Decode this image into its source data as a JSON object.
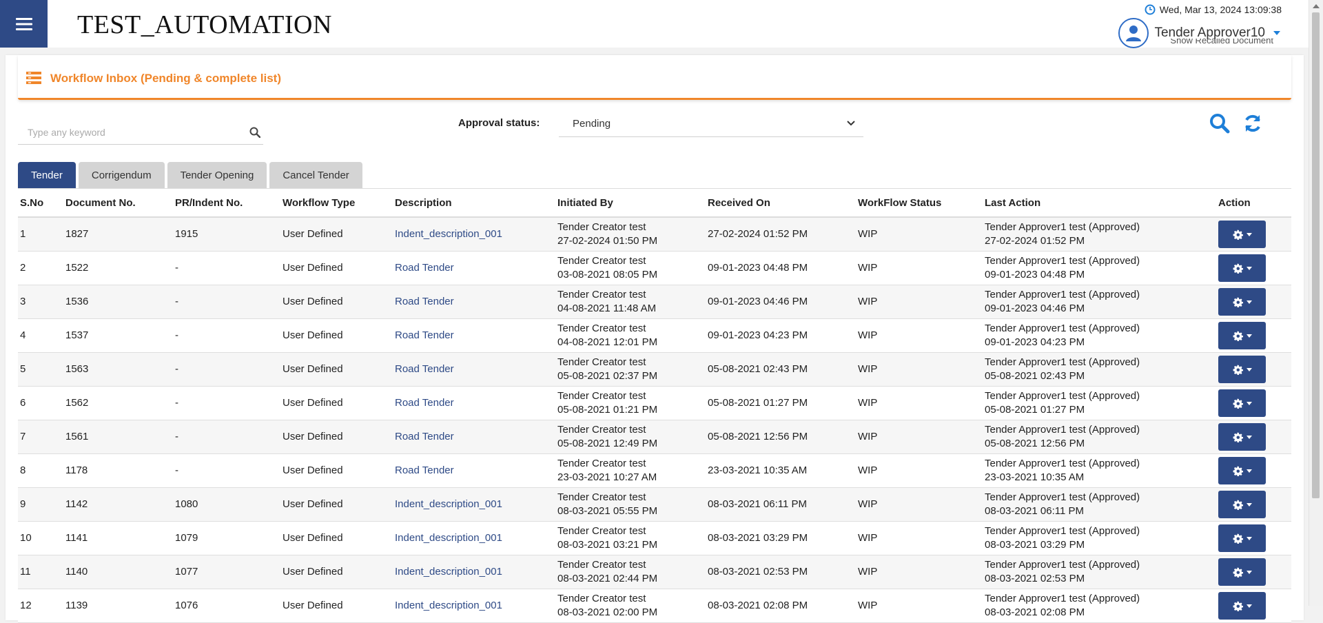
{
  "app": {
    "title": "TEST_AUTOMATION"
  },
  "header": {
    "datetime": "Wed, Mar 13, 2024 13:09:38",
    "user_name": "Tender Approver10",
    "recalled_link": "Show Recalled Document"
  },
  "panel": {
    "title": "Workflow Inbox (Pending & complete list)"
  },
  "search": {
    "placeholder": "Type any keyword",
    "value": ""
  },
  "filter": {
    "label": "Approval status:",
    "selected": "Pending"
  },
  "tabs": [
    {
      "label": "Tender",
      "active": true
    },
    {
      "label": "Corrigendum",
      "active": false
    },
    {
      "label": "Tender Opening",
      "active": false
    },
    {
      "label": "Cancel Tender",
      "active": false
    }
  ],
  "table": {
    "columns": [
      "S.No",
      "Document No.",
      "PR/Indent No.",
      "Workflow Type",
      "Description",
      "Initiated By",
      "Received On",
      "WorkFlow Status",
      "Last Action",
      "Action"
    ],
    "rows": [
      {
        "sno": "1",
        "doc": "1827",
        "pr": "1915",
        "type": "User Defined",
        "desc": "Indent_description_001",
        "init_by": "Tender Creator test",
        "init_date": "27-02-2024 01:50 PM",
        "received": "27-02-2024 01:52 PM",
        "status": "WIP",
        "last_action": "Tender Approver1 test (Approved)",
        "last_date": "27-02-2024 01:52 PM"
      },
      {
        "sno": "2",
        "doc": "1522",
        "pr": "-",
        "type": "User Defined",
        "desc": "Road Tender",
        "init_by": "Tender Creator test",
        "init_date": "03-08-2021 08:05 PM",
        "received": "09-01-2023 04:48 PM",
        "status": "WIP",
        "last_action": "Tender Approver1 test (Approved)",
        "last_date": "09-01-2023 04:48 PM"
      },
      {
        "sno": "3",
        "doc": "1536",
        "pr": "-",
        "type": "User Defined",
        "desc": "Road Tender",
        "init_by": "Tender Creator test",
        "init_date": "04-08-2021 11:48 AM",
        "received": "09-01-2023 04:46 PM",
        "status": "WIP",
        "last_action": "Tender Approver1 test (Approved)",
        "last_date": "09-01-2023 04:46 PM"
      },
      {
        "sno": "4",
        "doc": "1537",
        "pr": "-",
        "type": "User Defined",
        "desc": "Road Tender",
        "init_by": "Tender Creator test",
        "init_date": "04-08-2021 12:01 PM",
        "received": "09-01-2023 04:23 PM",
        "status": "WIP",
        "last_action": "Tender Approver1 test (Approved)",
        "last_date": "09-01-2023 04:23 PM"
      },
      {
        "sno": "5",
        "doc": "1563",
        "pr": "-",
        "type": "User Defined",
        "desc": "Road Tender",
        "init_by": "Tender Creator test",
        "init_date": "05-08-2021 02:37 PM",
        "received": "05-08-2021 02:43 PM",
        "status": "WIP",
        "last_action": "Tender Approver1 test (Approved)",
        "last_date": "05-08-2021 02:43 PM"
      },
      {
        "sno": "6",
        "doc": "1562",
        "pr": "-",
        "type": "User Defined",
        "desc": "Road Tender",
        "init_by": "Tender Creator test",
        "init_date": "05-08-2021 01:21 PM",
        "received": "05-08-2021 01:27 PM",
        "status": "WIP",
        "last_action": "Tender Approver1 test (Approved)",
        "last_date": "05-08-2021 01:27 PM"
      },
      {
        "sno": "7",
        "doc": "1561",
        "pr": "-",
        "type": "User Defined",
        "desc": "Road Tender",
        "init_by": "Tender Creator test",
        "init_date": "05-08-2021 12:49 PM",
        "received": "05-08-2021 12:56 PM",
        "status": "WIP",
        "last_action": "Tender Approver1 test (Approved)",
        "last_date": "05-08-2021 12:56 PM"
      },
      {
        "sno": "8",
        "doc": "1178",
        "pr": "-",
        "type": "User Defined",
        "desc": "Road Tender",
        "init_by": "Tender Creator test",
        "init_date": "23-03-2021 10:27 AM",
        "received": "23-03-2021 10:35 AM",
        "status": "WIP",
        "last_action": "Tender Approver1 test (Approved)",
        "last_date": "23-03-2021 10:35 AM"
      },
      {
        "sno": "9",
        "doc": "1142",
        "pr": "1080",
        "type": "User Defined",
        "desc": "Indent_description_001",
        "init_by": "Tender Creator test",
        "init_date": "08-03-2021 05:55 PM",
        "received": "08-03-2021 06:11 PM",
        "status": "WIP",
        "last_action": "Tender Approver1 test (Approved)",
        "last_date": "08-03-2021 06:11 PM"
      },
      {
        "sno": "10",
        "doc": "1141",
        "pr": "1079",
        "type": "User Defined",
        "desc": "Indent_description_001",
        "init_by": "Tender Creator test",
        "init_date": "08-03-2021 03:21 PM",
        "received": "08-03-2021 03:29 PM",
        "status": "WIP",
        "last_action": "Tender Approver1 test (Approved)",
        "last_date": "08-03-2021 03:29 PM"
      },
      {
        "sno": "11",
        "doc": "1140",
        "pr": "1077",
        "type": "User Defined",
        "desc": "Indent_description_001",
        "init_by": "Tender Creator test",
        "init_date": "08-03-2021 02:44 PM",
        "received": "08-03-2021 02:53 PM",
        "status": "WIP",
        "last_action": "Tender Approver1 test (Approved)",
        "last_date": "08-03-2021 02:53 PM"
      },
      {
        "sno": "12",
        "doc": "1139",
        "pr": "1076",
        "type": "User Defined",
        "desc": "Indent_description_001",
        "init_by": "Tender Creator test",
        "init_date": "08-03-2021 02:00 PM",
        "received": "08-03-2021 02:08 PM",
        "status": "WIP",
        "last_action": "Tender Approver1 test (Approved)",
        "last_date": "08-03-2021 02:08 PM"
      }
    ]
  },
  "icons": {
    "menu": "hamburger-icon",
    "clock": "clock-icon",
    "user": "user-avatar-icon",
    "search": "search-icon",
    "refresh": "refresh-icon",
    "gear": "gear-icon",
    "header": "list-icon"
  },
  "colors": {
    "primary": "#2e4a86",
    "accent": "#f0862a",
    "link": "#2e4a86",
    "icon_blue": "#1e7fd8"
  }
}
